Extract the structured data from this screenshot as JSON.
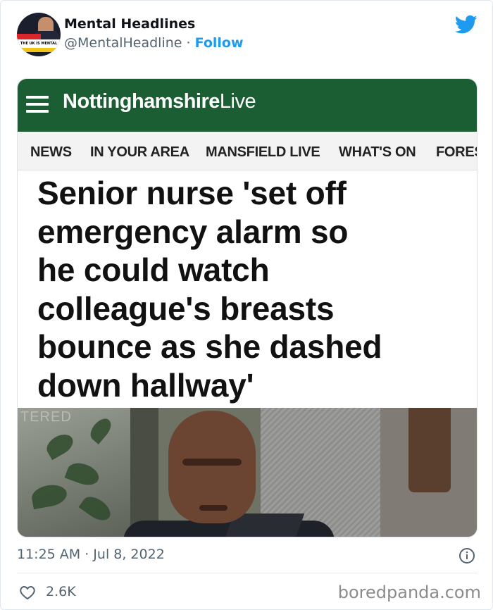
{
  "tweet": {
    "author": {
      "display_name": "Mental Headlines",
      "handle": "@MentalHeadline",
      "separator": "·",
      "follow_label": "Follow",
      "avatar_text": "THE UK IS MENTAL"
    },
    "embedded_article": {
      "site_name_bold": "Nottinghamshire",
      "site_name_light": "Live",
      "nav_items": [
        "NEWS",
        "IN YOUR AREA",
        "MANSFIELD LIVE",
        "WHAT'S ON",
        "FORES"
      ],
      "headline_lines": [
        "Senior nurse 'set off",
        "emergency alarm so",
        "he could watch",
        "colleague's breasts",
        "bounce as she dashed",
        "down hallway'"
      ],
      "photo_text": "TERED"
    },
    "timestamp": "11:25 AM · Jul 8, 2022",
    "likes": "2.6K"
  },
  "watermark": "boredpanda.com",
  "icons": {
    "platform": "twitter-bird-icon",
    "info": "info-icon",
    "like": "heart-icon",
    "menu": "hamburger-icon"
  },
  "colors": {
    "twitter_blue": "#1d9bf0",
    "site_green": "#1c5e33",
    "muted_text": "#536471"
  }
}
